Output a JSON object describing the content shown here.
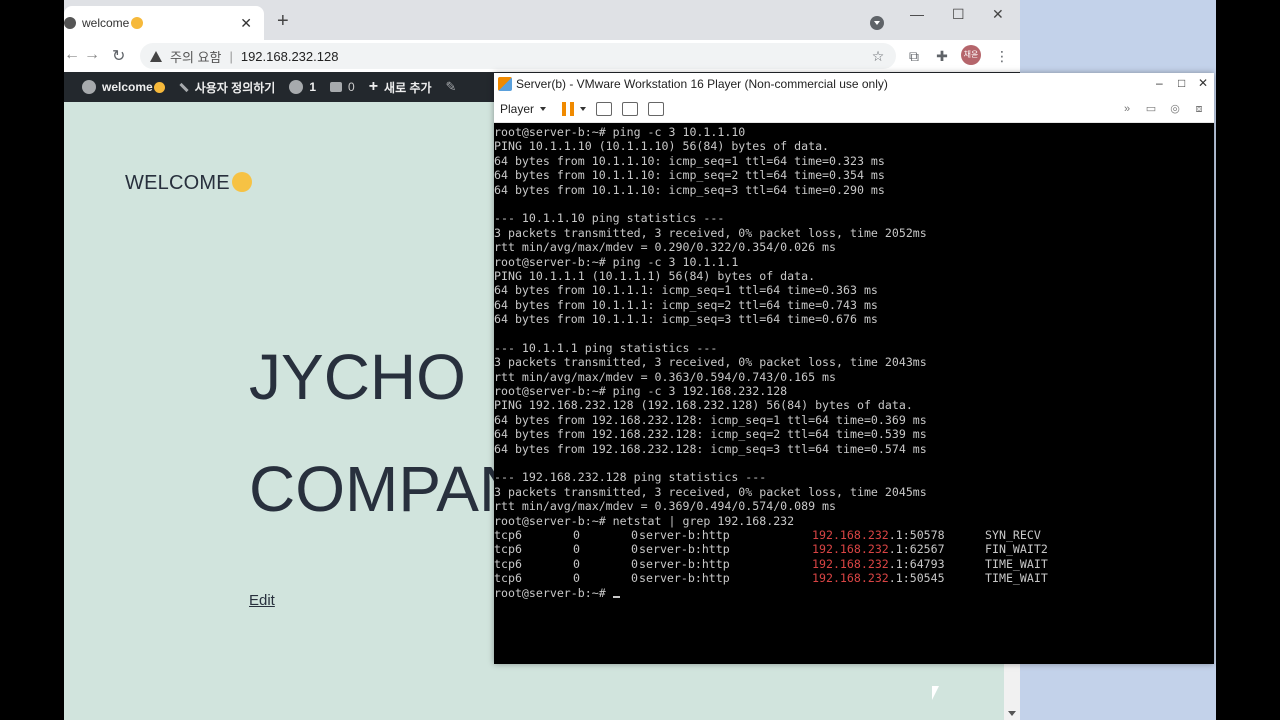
{
  "browser": {
    "tab_title": "welcome",
    "address_warning": "주의 요함",
    "url": "192.168.232.128",
    "avatar_text": "채윤",
    "icons": [
      "back-icon",
      "forward-icon",
      "reload-icon",
      "star-icon",
      "extensions-icon",
      "menu-dots-icon"
    ]
  },
  "wp_admin_bar": {
    "site_name": "welcome",
    "customize": "사용자 정의하기",
    "updates_count": "1",
    "comments_count": "0",
    "new_label": "새로 추가"
  },
  "page": {
    "welcome": "WELCOME",
    "hero_line1": "JYCHO",
    "hero_line2": "COMPANY",
    "edit_link": "Edit"
  },
  "vmware": {
    "title": "Server(b) - VMware Workstation 16 Player (Non-commercial use only)",
    "player_label": "Player"
  },
  "terminal": {
    "lines": [
      "root@server-b:~# ping -c 3 10.1.1.10",
      "PING 10.1.1.10 (10.1.1.10) 56(84) bytes of data.",
      "64 bytes from 10.1.1.10: icmp_seq=1 ttl=64 time=0.323 ms",
      "64 bytes from 10.1.1.10: icmp_seq=2 ttl=64 time=0.354 ms",
      "64 bytes from 10.1.1.10: icmp_seq=3 ttl=64 time=0.290 ms",
      "",
      "--- 10.1.1.10 ping statistics ---",
      "3 packets transmitted, 3 received, 0% packet loss, time 2052ms",
      "rtt min/avg/max/mdev = 0.290/0.322/0.354/0.026 ms",
      "root@server-b:~# ping -c 3 10.1.1.1",
      "PING 10.1.1.1 (10.1.1.1) 56(84) bytes of data.",
      "64 bytes from 10.1.1.1: icmp_seq=1 ttl=64 time=0.363 ms",
      "64 bytes from 10.1.1.1: icmp_seq=2 ttl=64 time=0.743 ms",
      "64 bytes from 10.1.1.1: icmp_seq=3 ttl=64 time=0.676 ms",
      "",
      "--- 10.1.1.1 ping statistics ---",
      "3 packets transmitted, 3 received, 0% packet loss, time 2043ms",
      "rtt min/avg/max/mdev = 0.363/0.594/0.743/0.165 ms",
      "root@server-b:~# ping -c 3 192.168.232.128",
      "PING 192.168.232.128 (192.168.232.128) 56(84) bytes of data.",
      "64 bytes from 192.168.232.128: icmp_seq=1 ttl=64 time=0.369 ms",
      "64 bytes from 192.168.232.128: icmp_seq=2 ttl=64 time=0.539 ms",
      "64 bytes from 192.168.232.128: icmp_seq=3 ttl=64 time=0.574 ms",
      "",
      "--- 192.168.232.128 ping statistics ---",
      "3 packets transmitted, 3 received, 0% packet loss, time 2045ms",
      "rtt min/avg/max/mdev = 0.369/0.494/0.574/0.089 ms",
      "root@server-b:~# netstat | grep 192.168.232"
    ],
    "netstat_rows": [
      {
        "proto": "tcp6",
        "recv": "0",
        "send": "0",
        "local": "server-b:http",
        "foreign_highlight": "192.168.232",
        "foreign_rest": ".1:50578",
        "state": "SYN_RECV"
      },
      {
        "proto": "tcp6",
        "recv": "0",
        "send": "0",
        "local": "server-b:http",
        "foreign_highlight": "192.168.232",
        "foreign_rest": ".1:62567",
        "state": "FIN_WAIT2"
      },
      {
        "proto": "tcp6",
        "recv": "0",
        "send": "0",
        "local": "server-b:http",
        "foreign_highlight": "192.168.232",
        "foreign_rest": ".1:64793",
        "state": "TIME_WAIT"
      },
      {
        "proto": "tcp6",
        "recv": "0",
        "send": "0",
        "local": "server-b:http",
        "foreign_highlight": "192.168.232",
        "foreign_rest": ".1:50545",
        "state": "TIME_WAIT"
      }
    ],
    "prompt": "root@server-b:~# "
  },
  "colors": {
    "page_bg": "#d1e4dd",
    "wp_bar": "#23282d",
    "grep_highlight": "#d94444",
    "vmware_accent": "#f08a00"
  }
}
